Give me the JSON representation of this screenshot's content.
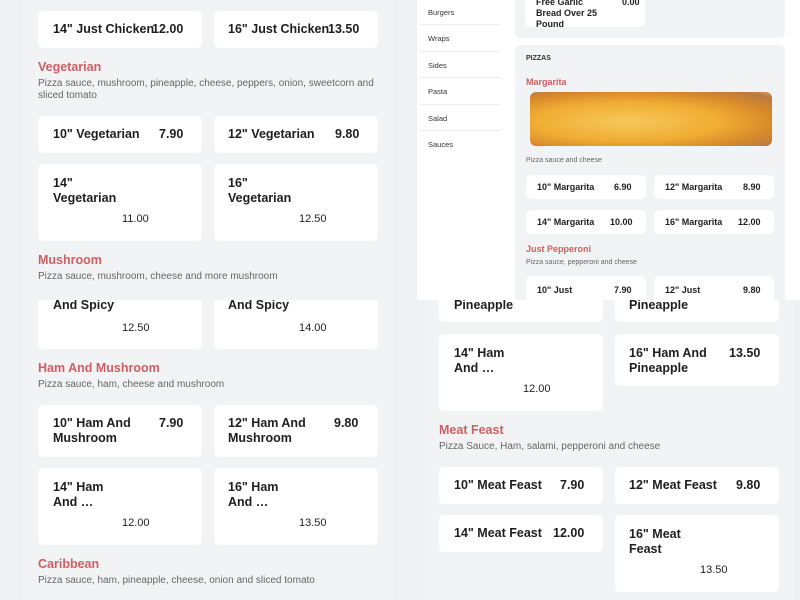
{
  "left_top": {
    "row_cards": [
      {
        "name": "14\" Just Chicken",
        "price": "12.00"
      },
      {
        "name": "16\" Just Chicken",
        "price": "13.50"
      }
    ],
    "vegetarian": {
      "title": "Vegetarian",
      "desc": "Pizza sauce, mushroom, pineapple, cheese, peppers, onion, sweetcorn and sliced tomato",
      "cards": [
        {
          "name": "10\" Vegetarian",
          "price": "7.90"
        },
        {
          "name": "12\" Vegetarian",
          "price": "9.80"
        },
        {
          "name": "14\" Vegetarian",
          "price": "11.00"
        },
        {
          "name": "16\" Vegetarian",
          "price": "12.50"
        }
      ]
    },
    "mushroom": {
      "title": "Mushroom",
      "desc": "Pizza sauce, mushroom, cheese and more mushroom"
    }
  },
  "left_bottom": {
    "row_cards": [
      {
        "name": "And Spicy",
        "price": "12.50"
      },
      {
        "name": "And Spicy",
        "price": "14.00"
      }
    ],
    "ham_mushroom": {
      "title": "Ham And Mushroom",
      "desc": "Pizza sauce, ham, cheese and mushroom",
      "cards": [
        {
          "name": "10\" Ham And Mushroom",
          "price": "7.90"
        },
        {
          "name": "12\" Ham And Mushroom",
          "price": "9.80"
        },
        {
          "name": "14\" Ham And …",
          "price": "12.00"
        },
        {
          "name": "16\" Ham And …",
          "price": "13.50"
        }
      ]
    },
    "caribbean": {
      "title": "Caribbean",
      "desc": "Pizza sauce, ham, pineapple, cheese, onion and sliced tomato"
    }
  },
  "right_top": {
    "categories": [
      "Burgers",
      "Wraps",
      "Sides",
      "Pasta",
      "Salad",
      "Sauces"
    ],
    "promo": {
      "name": "Free Garlic Bread Over 25 Pound",
      "price": "0.00"
    },
    "section_header": "PIZZAS",
    "margarita": {
      "title": "Margarita",
      "desc": "Pizza sauce and cheese",
      "cards": [
        {
          "name": "10\" Margarita",
          "price": "6.90"
        },
        {
          "name": "12\" Margarita",
          "price": "8.90"
        },
        {
          "name": "14\" Margarita",
          "price": "10.00"
        },
        {
          "name": "16\" Margarita",
          "price": "12.00"
        }
      ]
    },
    "pepperoni": {
      "title": "Just Pepperoni",
      "desc": "Pizza sauce, pepperoni and cheese",
      "cards": [
        {
          "name": "10\" Just",
          "price": "7.90"
        },
        {
          "name": "12\" Just",
          "price": "9.80"
        }
      ]
    }
  },
  "right_bottom": {
    "row_cards": [
      {
        "name": "Pineapple"
      },
      {
        "name": "Pineapple"
      }
    ],
    "ham_pineapple_cards": [
      {
        "name": "14\" Ham And …",
        "price": "12.00"
      },
      {
        "name": "16\" Ham And Pineapple",
        "price": "13.50"
      }
    ],
    "meat_feast": {
      "title": "Meat Feast",
      "desc": "Pizza Sauce, Ham, salami, pepperoni and cheese",
      "cards": [
        {
          "name": "10\" Meat Feast",
          "price": "7.90"
        },
        {
          "name": "12\" Meat Feast",
          "price": "9.80"
        },
        {
          "name": "14\" Meat Feast",
          "price": "12.00"
        },
        {
          "name": "16\" Meat Feast",
          "price": "13.50"
        }
      ]
    }
  }
}
